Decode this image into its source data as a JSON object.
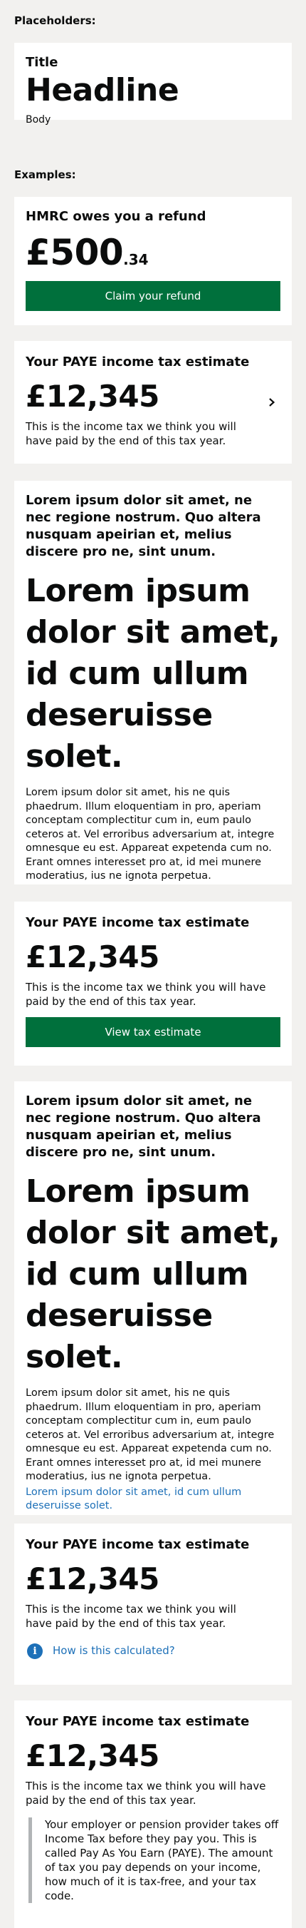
{
  "placeholders_label": "Placeholders:",
  "examples_label": "Examples:",
  "placeholder_card": {
    "title": "Title",
    "headline": "Headline",
    "body": "Body"
  },
  "refund_card": {
    "title": "HMRC owes you a refund",
    "amount_main": "£500",
    "amount_pence": ".34",
    "button": "Claim your refund"
  },
  "paye_card_chevron": {
    "title": "Your PAYE income tax estimate",
    "amount": "£12,345",
    "body": "This is the income tax we think you will have paid by the end of this tax year."
  },
  "lorem_card_1": {
    "title": "Lorem ipsum dolor sit amet, ne nec regione nostrum. Quo altera nusquam apeirian et, melius discere pro ne, sint unum.",
    "headline": "Lorem ipsum dolor sit amet, id cum ullum deseruisse solet.",
    "body": "Lorem ipsum dolor sit amet, his ne quis phaedrum. Illum eloquentiam in pro, aperiam conceptam complectitur cum in, eum paulo ceteros at. Vel erroribus adversarium at, integre omnesque eu est. Appareat expetenda cum no. Erant omnes interesset pro at, id mei munere moderatius, ius ne ignota perpetua."
  },
  "paye_card_button": {
    "title": "Your PAYE income tax estimate",
    "amount": "£12,345",
    "body": "This is the income tax we think you will have paid by the end of this tax year.",
    "button": "View tax estimate"
  },
  "lorem_card_2": {
    "title": "Lorem ipsum dolor sit amet, ne nec regione nostrum. Quo altera nusquam apeirian et, melius discere pro ne, sint unum.",
    "headline": "Lorem ipsum dolor sit amet, id cum ullum deseruisse solet.",
    "body": "Lorem ipsum dolor sit amet, his ne quis phaedrum. Illum eloquentiam in pro, aperiam conceptam complectitur cum in, eum paulo ceteros at. Vel erroribus adversarium at, integre omnesque eu est. Appareat expetenda cum no. Erant omnes interesset pro at, id mei munere moderatius, ius ne ignota perpetua.",
    "link": "Lorem ipsum dolor sit amet, id cum ullum deseruisse solet."
  },
  "paye_card_info": {
    "title": "Your PAYE income tax estimate",
    "amount": "£12,345",
    "body": "This is the income tax we think you will have paid by the end of this tax year.",
    "info_link": "How is this calculated?",
    "info_icon": "info-icon"
  },
  "paye_card_inset": {
    "title": "Your PAYE income tax estimate",
    "amount": "£12,345",
    "body": "This is the income tax we think you will have paid by the end of this tax year.",
    "inset": "Your employer or pension provider takes off Income Tax before they pay you. This is called Pay As You Earn (PAYE). The amount of tax you pay depends on your income, how much of it is tax-free, and your tax code."
  },
  "colors": {
    "background": "#f2f1ef",
    "card": "#ffffff",
    "button_green": "#00703c",
    "link_blue": "#1d70b8",
    "inset_border": "#b1b4b6"
  }
}
